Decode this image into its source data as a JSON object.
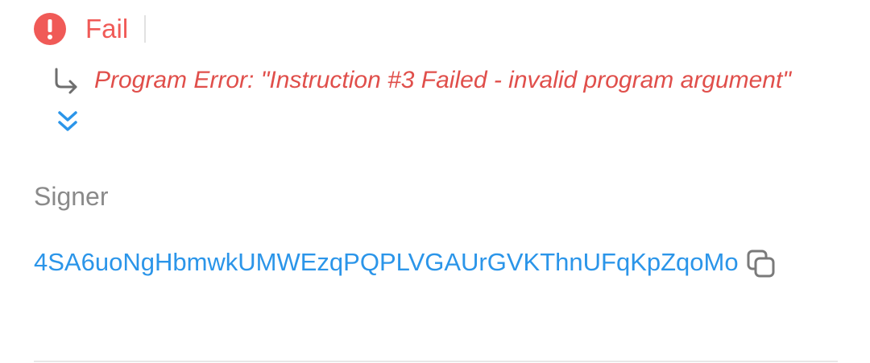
{
  "status": {
    "label": "Fail",
    "icon": "error-circle-icon",
    "color": "#f05a57"
  },
  "error": {
    "message": "Program Error: \"Instruction #3 Failed - invalid program argument\"",
    "icon": "return-arrow-icon",
    "color": "#e04f4b"
  },
  "expand": {
    "icon": "double-chevron-down-icon",
    "color": "#2b95e9"
  },
  "signer": {
    "label": "Signer",
    "value": "4SA6uoNgHbmwkUMWEzqPQPLVGAUrGVKThnUFqKpZqoMo",
    "copy_icon": "copy-icon",
    "link_color": "#2b95e9"
  }
}
